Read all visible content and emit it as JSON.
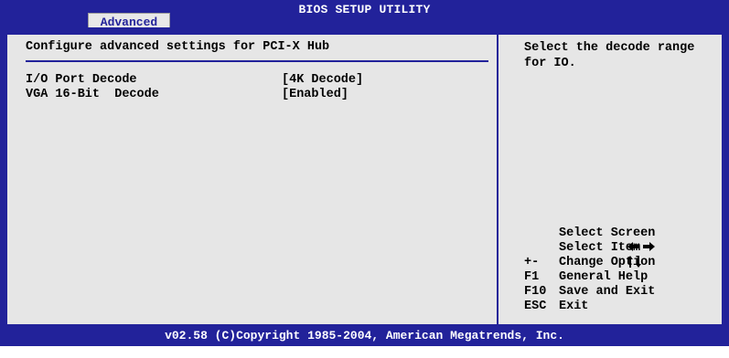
{
  "header": {
    "title": "BIOS SETUP UTILITY",
    "active_tab": "Advanced"
  },
  "main": {
    "section_title": "Configure advanced settings for PCI-X Hub",
    "settings": [
      {
        "name": "I/O Port Decode",
        "value": "[4K Decode]"
      },
      {
        "name": "VGA 16-Bit  Decode",
        "value": "[Enabled]"
      }
    ]
  },
  "help": {
    "text": "Select the decode range for IO.",
    "keys": [
      {
        "key_icon": "left-right-arrows-icon",
        "key": "",
        "desc": "Select Screen"
      },
      {
        "key_icon": "up-down-arrows-icon",
        "key": "",
        "desc": "Select Item"
      },
      {
        "key": "+-",
        "desc": "Change Option"
      },
      {
        "key": "F1",
        "desc": "General Help"
      },
      {
        "key": "F10",
        "desc": "Save and Exit"
      },
      {
        "key": "ESC",
        "desc": "Exit"
      }
    ]
  },
  "footer": {
    "copyright": "v02.58 (C)Copyright 1985-2004, American Megatrends, Inc."
  },
  "colors": {
    "frame_blue": "#22229a",
    "panel_gray": "#e6e6e6",
    "text": "#000000"
  }
}
